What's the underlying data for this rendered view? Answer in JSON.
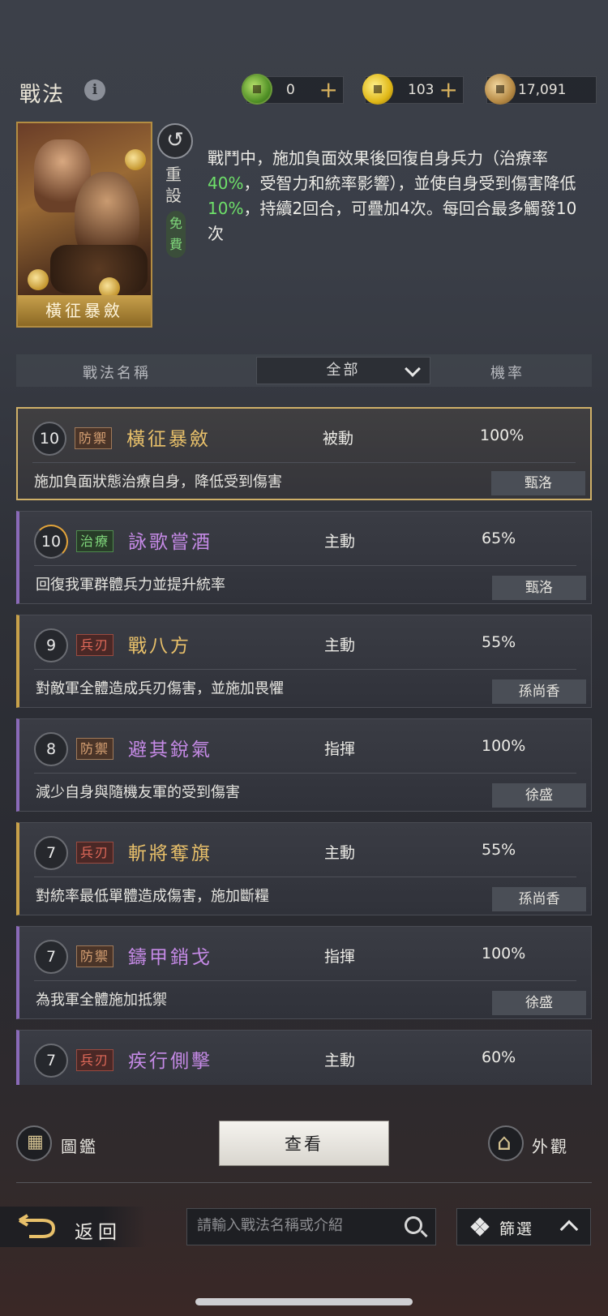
{
  "header": {
    "title": "戰法",
    "resources": [
      {
        "icon": "jade-coin-icon",
        "value": "0",
        "plus": "+"
      },
      {
        "icon": "gold-coin-icon",
        "value": "103",
        "plus": "+"
      },
      {
        "icon": "copper-coin-icon",
        "value": "17,091"
      }
    ]
  },
  "detail": {
    "card_name": "橫征暴斂",
    "reset_label": "重設",
    "free_label": "免費",
    "description": {
      "p1": "戰鬥中，施加負面效果後回復自身兵力（治療率",
      "h1": "40%",
      "p2": "，受智力和統率影響），並使自身受到傷害降低",
      "h2": "10%",
      "p3": "，持續2回合，可疊加4次。每回合最多觸發10次"
    }
  },
  "table_header": {
    "col_name": "戰法名稱",
    "filter_value": "全部",
    "col_rate": "機率"
  },
  "tactics": [
    {
      "level": "10",
      "tag": "防禦",
      "name": "橫征暴斂",
      "type": "被動",
      "rate": "100%",
      "desc": "施加負面狀態治療自身，降低受到傷害",
      "hero": "甄洛"
    },
    {
      "level": "10",
      "tag": "治療",
      "name": "詠歌嘗酒",
      "type": "主動",
      "rate": "65%",
      "desc": "回復我軍群體兵力並提升統率",
      "hero": "甄洛"
    },
    {
      "level": "9",
      "tag": "兵刃",
      "name": "戰八方",
      "type": "主動",
      "rate": "55%",
      "desc": "對敵軍全體造成兵刃傷害，並施加畏懼",
      "hero": "孫尚香"
    },
    {
      "level": "8",
      "tag": "防禦",
      "name": "避其銳氣",
      "type": "指揮",
      "rate": "100%",
      "desc": "減少自身與隨機友軍的受到傷害",
      "hero": "徐盛"
    },
    {
      "level": "7",
      "tag": "兵刃",
      "name": "斬將奪旗",
      "type": "主動",
      "rate": "55%",
      "desc": "對統率最低單體造成傷害，施加斷糧",
      "hero": "孫尚香"
    },
    {
      "level": "7",
      "tag": "防禦",
      "name": "鑄甲銷戈",
      "type": "指揮",
      "rate": "100%",
      "desc": "為我軍全體施加抵禦",
      "hero": "徐盛"
    },
    {
      "level": "7",
      "tag": "兵刃",
      "name": "疾行側擊",
      "type": "主動",
      "rate": "60%",
      "desc": "",
      "hero": ""
    }
  ],
  "actions": {
    "codex_label": "圖鑑",
    "view_label": "查看",
    "appearance_label": "外觀"
  },
  "footer": {
    "back_label": "返回",
    "search_placeholder": "請輸入戰法名稱或介紹",
    "filter_label": "篩選"
  }
}
